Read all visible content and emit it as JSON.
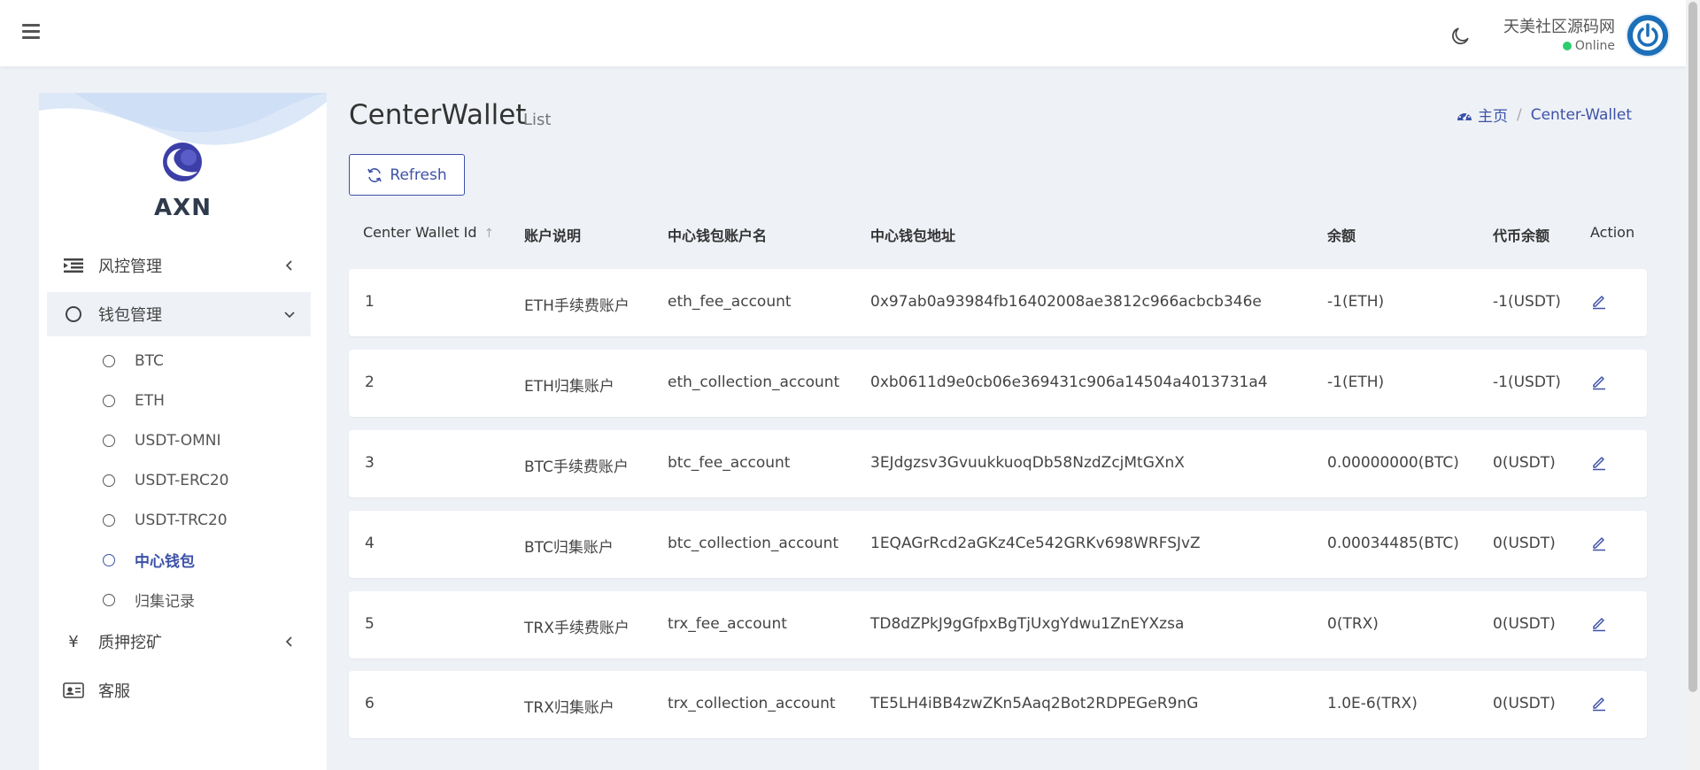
{
  "header": {
    "user_name": "天美社区源码网",
    "user_status": "Online"
  },
  "sidebar": {
    "brand": "AXN",
    "menu": [
      {
        "label": "风控管理"
      },
      {
        "label": "钱包管理"
      },
      {
        "label": "质押挖矿"
      },
      {
        "label": "客服"
      }
    ],
    "submenu": [
      {
        "label": "BTC"
      },
      {
        "label": "ETH"
      },
      {
        "label": "USDT-OMNI"
      },
      {
        "label": "USDT-ERC20"
      },
      {
        "label": "USDT-TRC20"
      },
      {
        "label": "中心钱包"
      },
      {
        "label": "归集记录"
      }
    ],
    "yen_symbol": "¥"
  },
  "page": {
    "title": "CenterWallet",
    "subtitle": "List",
    "breadcrumb_home": "主页",
    "breadcrumb_current": "Center-Wallet",
    "refresh_label": "Refresh"
  },
  "table": {
    "columns": [
      "Center Wallet Id",
      "账户说明",
      "中心钱包账户名",
      "中心钱包地址",
      "余额",
      "代币余额",
      "Action"
    ],
    "sort_indicator": "↑",
    "rows": [
      {
        "id": "1",
        "desc": "ETH手续费账户",
        "name": "eth_fee_account",
        "address": "0x97ab0a93984fb16402008ae3812c966acbcb346e",
        "balance": "-1(ETH)",
        "token_balance": "-1(USDT)"
      },
      {
        "id": "2",
        "desc": "ETH归集账户",
        "name": "eth_collection_account",
        "address": "0xb0611d9e0cb06e369431c906a14504a4013731a4",
        "balance": "-1(ETH)",
        "token_balance": "-1(USDT)"
      },
      {
        "id": "3",
        "desc": "BTC手续费账户",
        "name": "btc_fee_account",
        "address": "3EJdgzsv3GvuukkuoqDb58NzdZcjMtGXnX",
        "balance": "0.00000000(BTC)",
        "token_balance": "0(USDT)"
      },
      {
        "id": "4",
        "desc": "BTC归集账户",
        "name": "btc_collection_account",
        "address": "1EQAGrRcd2aGKz4Ce542GRKv698WRFSJvZ",
        "balance": "0.00034485(BTC)",
        "token_balance": "0(USDT)"
      },
      {
        "id": "5",
        "desc": "TRX手续费账户",
        "name": "trx_fee_account",
        "address": "TD8dZPkJ9gGfpxBgTjUxgYdwu1ZnEYXzsa",
        "balance": "0(TRX)",
        "token_balance": "0(USDT)"
      },
      {
        "id": "6",
        "desc": "TRX归集账户",
        "name": "trx_collection_account",
        "address": "TE5LH4iBB4zwZKn5Aaq2Bot2RDPEGeR9nG",
        "balance": "1.0E-6(TRX)",
        "token_balance": "0(USDT)"
      }
    ]
  },
  "colors": {
    "accent": "#3d52a8",
    "online": "#2ecc71",
    "background": "#eef1f6"
  }
}
